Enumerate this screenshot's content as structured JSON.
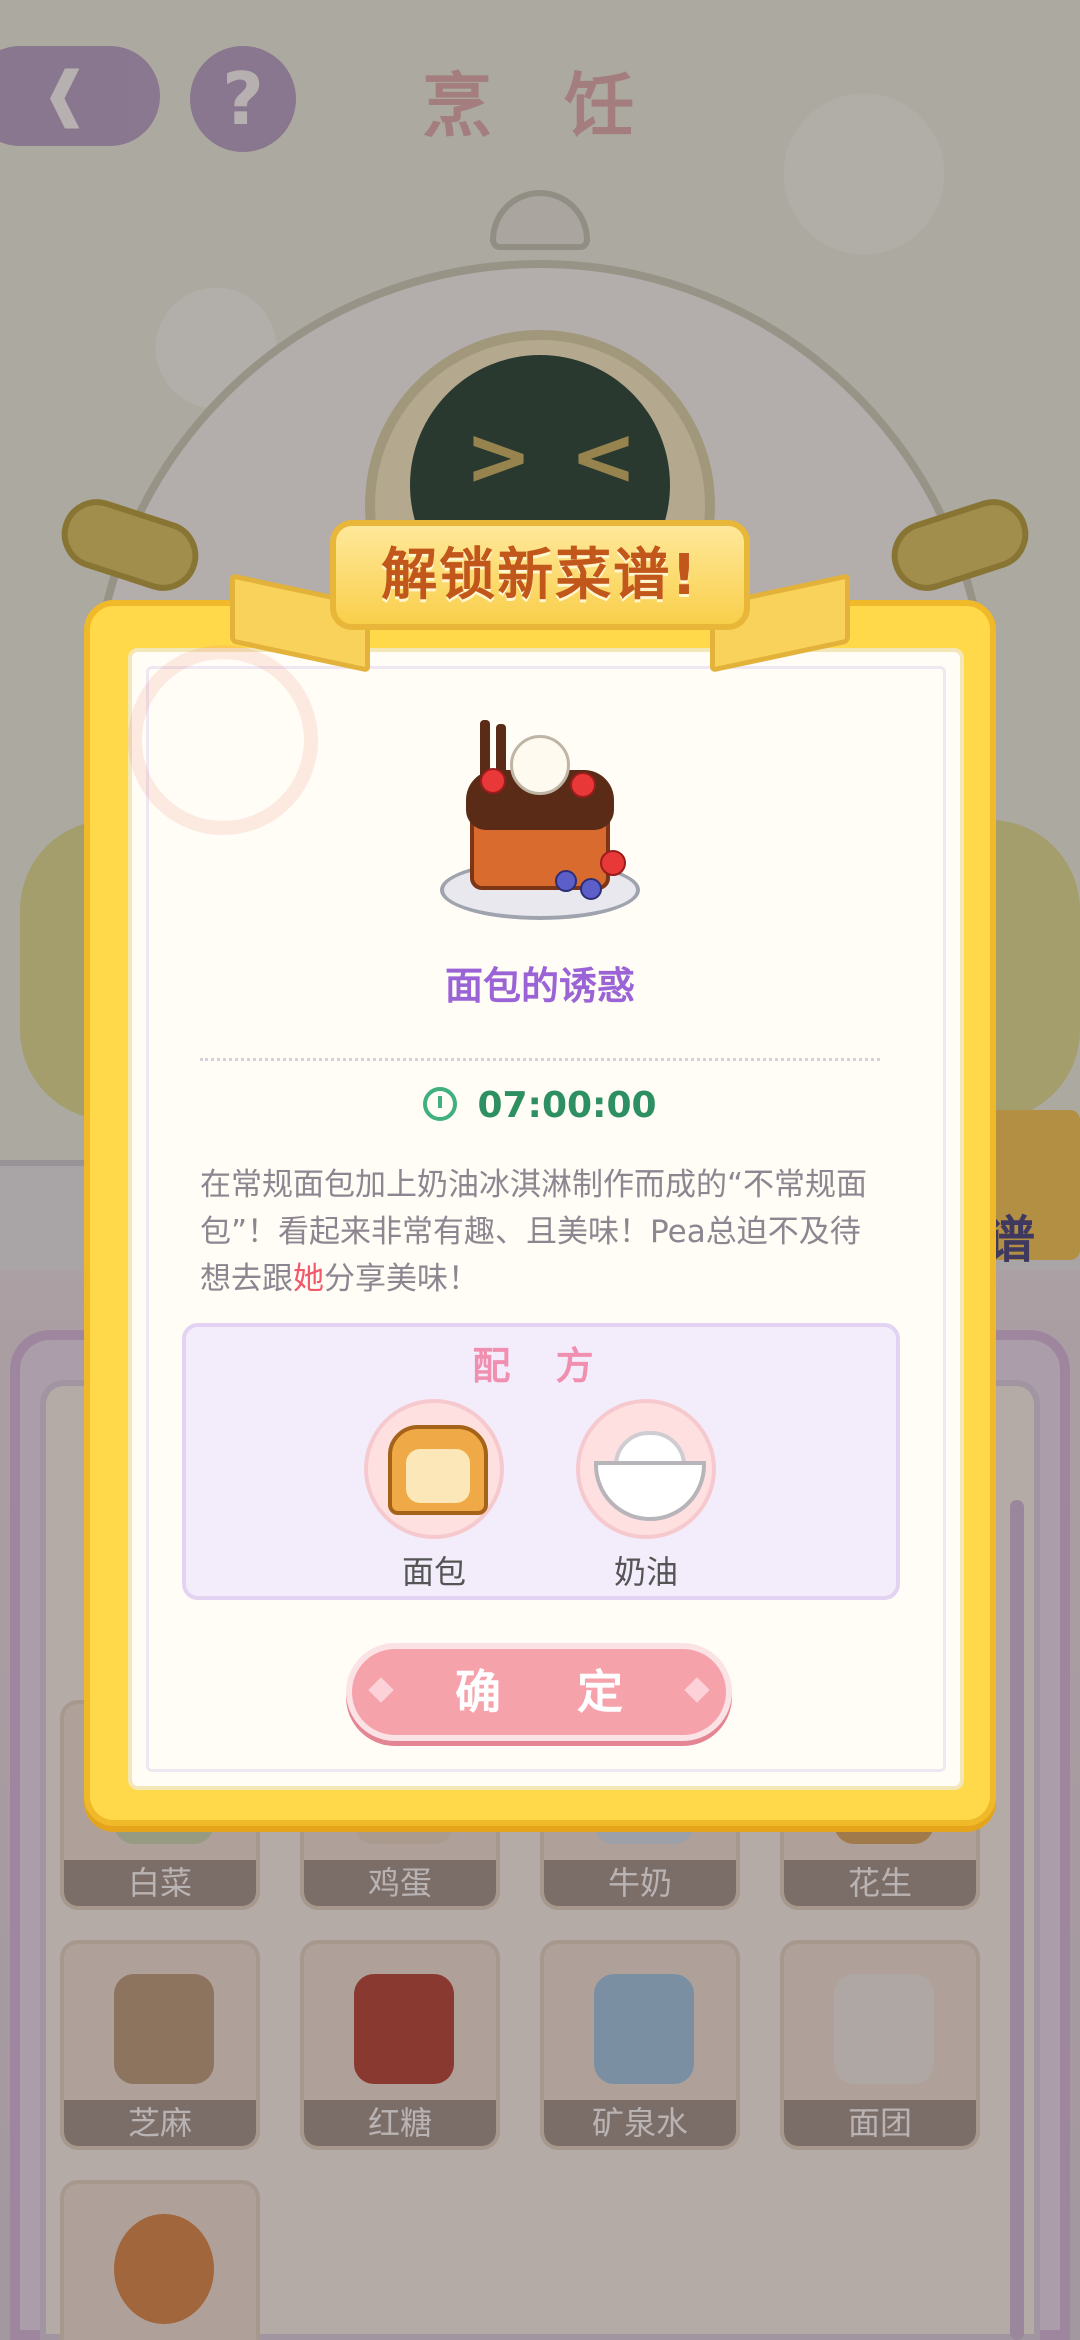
{
  "header": {
    "title": "烹 饪",
    "help_label": "?"
  },
  "popup": {
    "banner": "解锁新菜谱!",
    "dish_name": "面包的诱惑",
    "time": "07:00:00",
    "description_part1": "在常规面包加上奶油冰淇淋制作而成的“不常规面包”！看起来非常有趣、且美味！Pea总迫不及待想去跟",
    "description_highlight": "她",
    "description_part2": "分享美味！",
    "recipe_title": "配 方",
    "ingredients": [
      {
        "name": "面包",
        "icon": "bread-icon"
      },
      {
        "name": "奶油",
        "icon": "cream-icon"
      }
    ],
    "confirm_label": "确 定"
  },
  "ingredient_grid": [
    {
      "name": "白菜",
      "icon": "cabbage-icon",
      "color": "#c9d9b0"
    },
    {
      "name": "鸡蛋",
      "icon": "egg-icon",
      "color": "#e8d8c4"
    },
    {
      "name": "牛奶",
      "icon": "milk-icon",
      "color": "#cfe0ef"
    },
    {
      "name": "花生",
      "icon": "peanut-icon",
      "color": "#d9a35a"
    },
    {
      "name": "芝麻",
      "icon": "sesame-icon",
      "color": "#b89a78"
    },
    {
      "name": "红糖",
      "icon": "brown-sugar-icon",
      "color": "#b33a2c"
    },
    {
      "name": "矿泉水",
      "icon": "water-bottle-icon",
      "color": "#9cc6e6"
    },
    {
      "name": "面团",
      "icon": "dough-icon",
      "color": "#efece6"
    },
    {
      "name": "",
      "icon": "bagel-icon",
      "color": "#d9843e"
    }
  ],
  "side_tab": {
    "label": "谱"
  },
  "colors": {
    "accent": "#9b64d6",
    "time": "#2e8f62",
    "highlight": "#f2576a",
    "confirm": "#f5a2ab",
    "banner_text": "#c2571b"
  }
}
